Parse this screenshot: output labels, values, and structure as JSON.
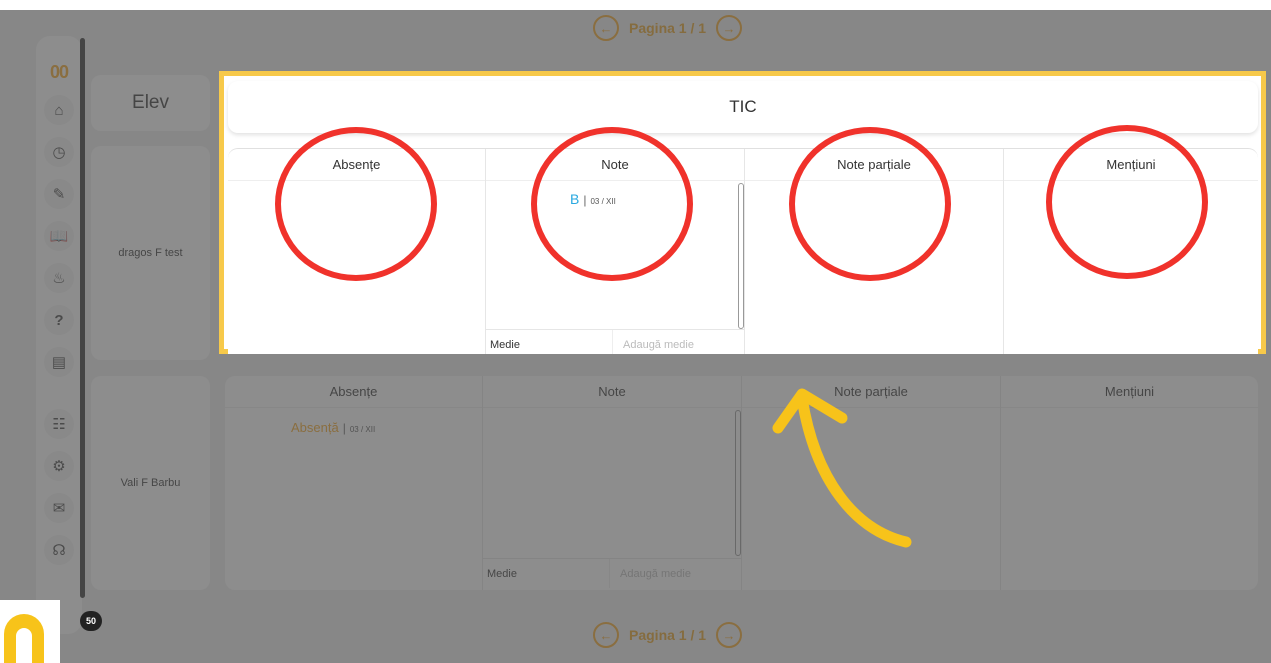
{
  "pager": {
    "label": "Pagina 1 / 1",
    "prev_icon": "arrow-left-icon",
    "next_icon": "arrow-right-icon"
  },
  "sidebar": {
    "logo": "00",
    "icons": [
      "home-icon",
      "clock-icon",
      "pencil-icon",
      "book-icon",
      "bell-icon",
      "help-icon",
      "document-icon",
      "contact-card-icon",
      "settings-icon",
      "mail-icon",
      "headset-icon"
    ],
    "badge": "50"
  },
  "elev_header": "Elev",
  "subject_title": "TIC",
  "columns": [
    "Absențe",
    "Note",
    "Note parțiale",
    "Mențiuni"
  ],
  "students": [
    {
      "name": "dragos F test",
      "grades": [
        {
          "value": "B",
          "date": "03 / XII"
        }
      ],
      "absences": [],
      "medie_label": "Medie",
      "medie_placeholder": "Adaugă medie"
    },
    {
      "name": "Vali F Barbu",
      "grades": [],
      "absences": [
        {
          "label": "Absență",
          "date": "03 / XII"
        }
      ],
      "medie_label": "Medie",
      "medie_placeholder": "Adaugă medie"
    }
  ],
  "colors": {
    "accent": "#f5a623",
    "highlight_border": "#f7c94a",
    "annotation_red": "#f0322b",
    "grade_blue": "#29a8e0"
  }
}
